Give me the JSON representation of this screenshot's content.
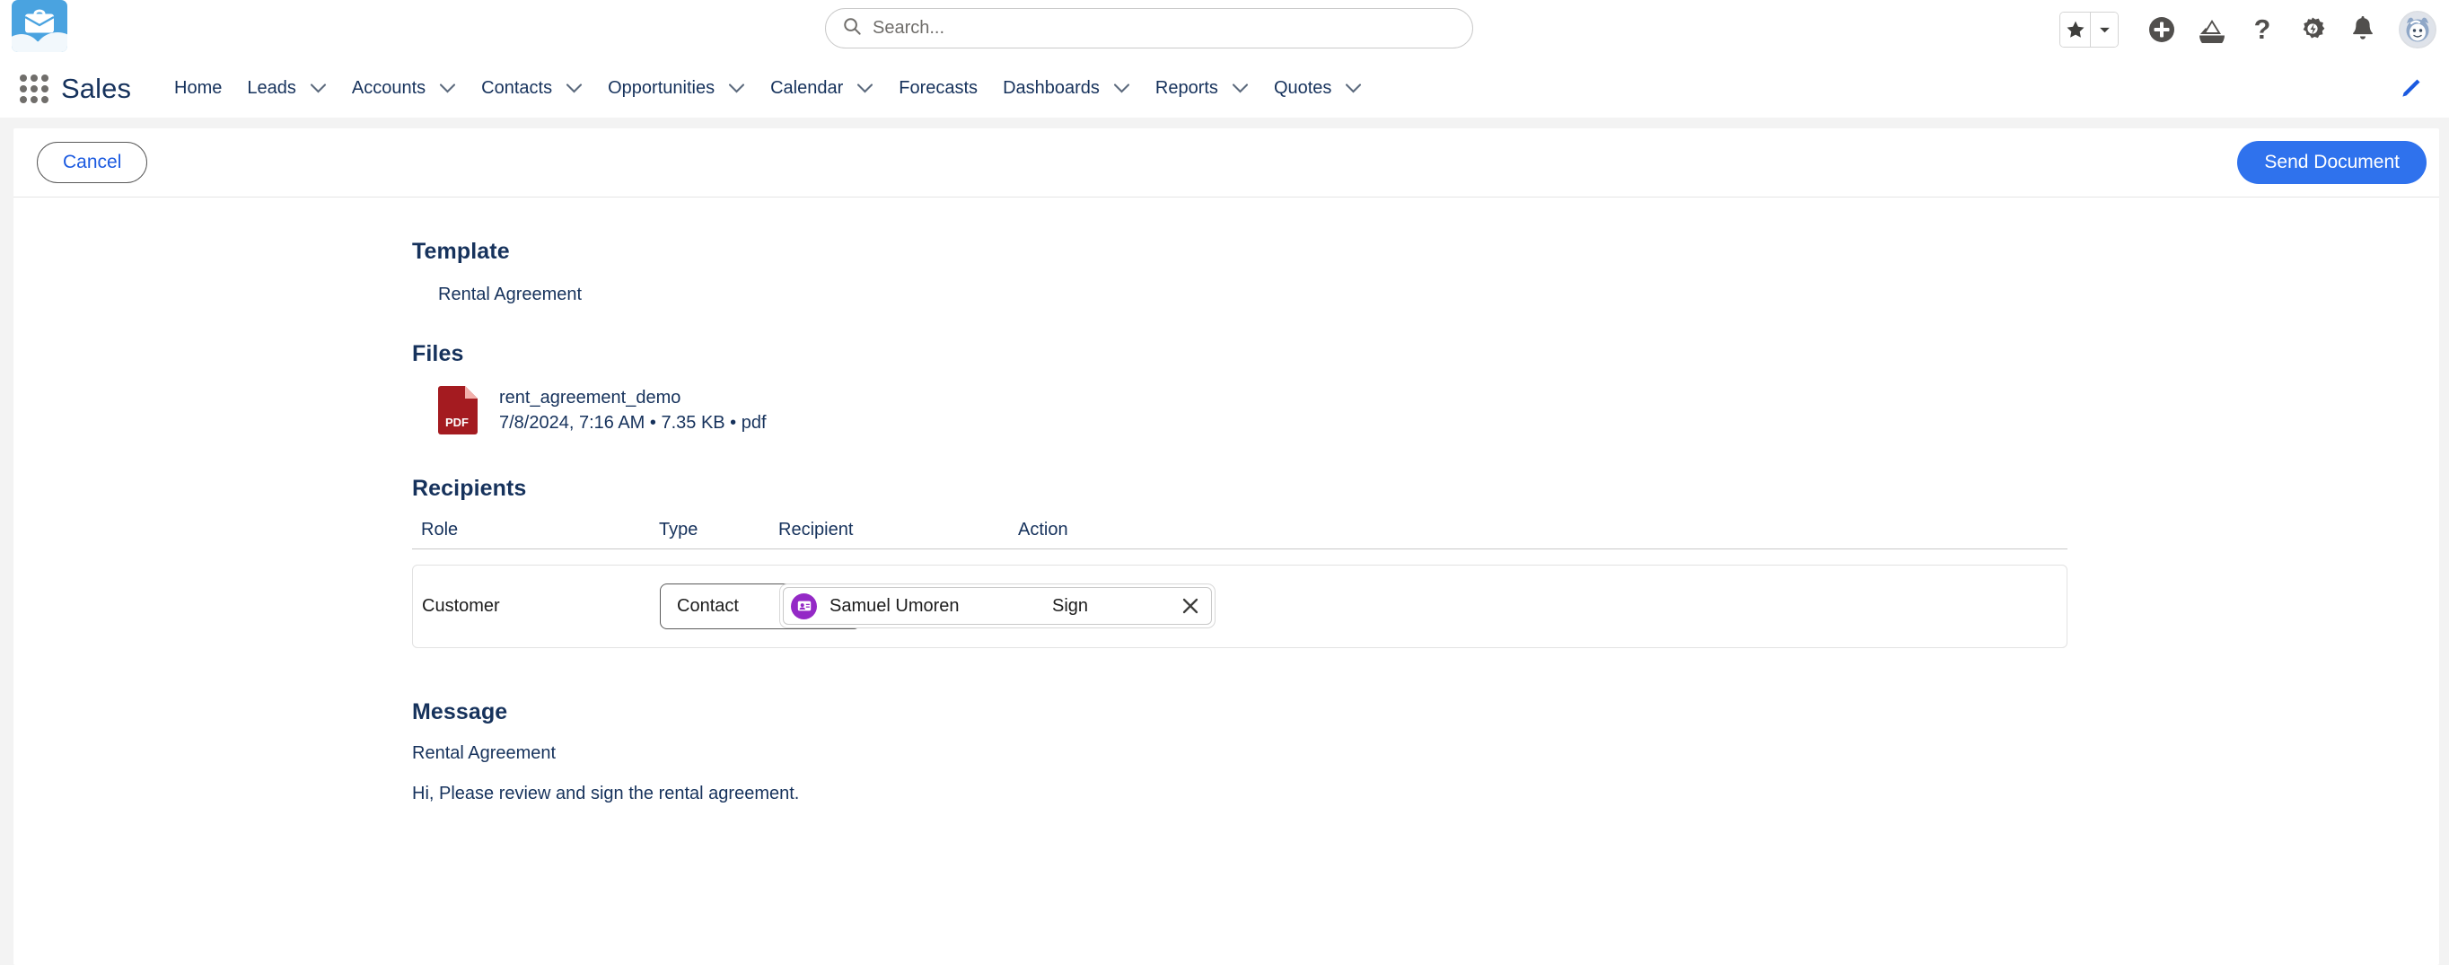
{
  "header": {
    "logo_icon": "salesforce-briefcase-cloud-logo",
    "search": {
      "placeholder": "Search...",
      "value": "",
      "icon": "search-icon"
    },
    "actions": [
      {
        "name": "favorites-star",
        "icon": "star-icon"
      },
      {
        "name": "favorites-dropdown",
        "icon": "chevron-down-icon"
      },
      {
        "name": "global-create",
        "icon": "plus-circle-icon"
      },
      {
        "name": "einstein",
        "icon": "einstein-mountain-icon"
      },
      {
        "name": "help",
        "icon": "question-mark-icon"
      },
      {
        "name": "setup",
        "icon": "gear-icon"
      },
      {
        "name": "notifications",
        "icon": "bell-icon"
      },
      {
        "name": "user-profile",
        "icon": "avatar-icon"
      }
    ]
  },
  "nav": {
    "app_launcher_icon": "app-launcher-grid-icon",
    "app_name": "Sales",
    "edit_icon": "pencil-icon",
    "items": [
      {
        "label": "Home",
        "has_menu": false
      },
      {
        "label": "Leads",
        "has_menu": true
      },
      {
        "label": "Accounts",
        "has_menu": true
      },
      {
        "label": "Contacts",
        "has_menu": true
      },
      {
        "label": "Opportunities",
        "has_menu": true
      },
      {
        "label": "Calendar",
        "has_menu": true
      },
      {
        "label": "Forecasts",
        "has_menu": false
      },
      {
        "label": "Dashboards",
        "has_menu": true
      },
      {
        "label": "Reports",
        "has_menu": true
      },
      {
        "label": "Quotes",
        "has_menu": true
      }
    ]
  },
  "actionbar": {
    "cancel_label": "Cancel",
    "send_label": "Send Document"
  },
  "main": {
    "template": {
      "heading": "Template",
      "value": "Rental Agreement"
    },
    "files": {
      "heading": "Files",
      "items": [
        {
          "icon": "pdf-file-icon",
          "icon_label": "PDF",
          "name": "rent_agreement_demo",
          "meta": "7/8/2024, 7:16 AM • 7.35 KB • pdf"
        }
      ]
    },
    "recipients": {
      "heading": "Recipients",
      "columns": [
        "Role",
        "Type",
        "Recipient",
        "Action"
      ],
      "rows": [
        {
          "role": "Customer",
          "type": "Contact",
          "type_caret_icon": "caret-down-icon",
          "recipient_name": "Samuel Umoren",
          "recipient_icon": "contact-badge-icon",
          "remove_icon": "close-x-icon",
          "action": "Sign"
        }
      ]
    },
    "message": {
      "heading": "Message",
      "subject": "Rental Agreement",
      "body": "Hi, Please review and sign the rental agreement."
    }
  },
  "colors": {
    "brand_blue": "#2f72ed",
    "link_blue": "#1b5ae0",
    "nav_text": "#16325c",
    "pdf_red": "#a41b20",
    "contact_purple": "#9429c6",
    "logo_blue": "#4aa3e0",
    "page_bg": "#f3f3f3"
  }
}
